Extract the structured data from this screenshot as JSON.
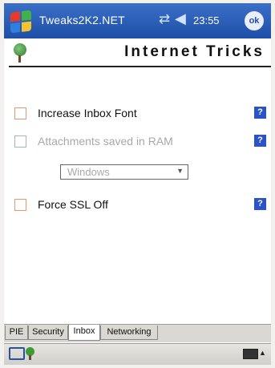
{
  "titlebar": {
    "app_title": "Tweaks2K2.NET",
    "time": "23:55",
    "ok_label": "ok"
  },
  "header": {
    "title": "Internet Tricks"
  },
  "options": [
    {
      "label": "Increase Inbox Font",
      "checked": false,
      "enabled": true,
      "help": "?"
    },
    {
      "label": "Attachments saved in RAM",
      "checked": false,
      "enabled": false,
      "help": "?"
    },
    {
      "label": "Force SSL Off",
      "checked": false,
      "enabled": true,
      "help": "?"
    }
  ],
  "dropdown": {
    "value": "Windows",
    "enabled": false
  },
  "tabs": [
    {
      "label": "PIE",
      "active": false
    },
    {
      "label": "Security",
      "active": false
    },
    {
      "label": "Inbox",
      "active": true
    },
    {
      "label": "Networking",
      "active": false
    }
  ],
  "icons": {
    "start": "windows-start-icon",
    "network": "network-icon",
    "volume": "volume-icon",
    "keyboard": "keyboard-icon",
    "app": "tree-icon",
    "sip": "input-panel-icon"
  },
  "colors": {
    "titlebar": "#1f4fa8",
    "help_button": "#2a52c9",
    "checkbox_border": "#e09a6e"
  }
}
